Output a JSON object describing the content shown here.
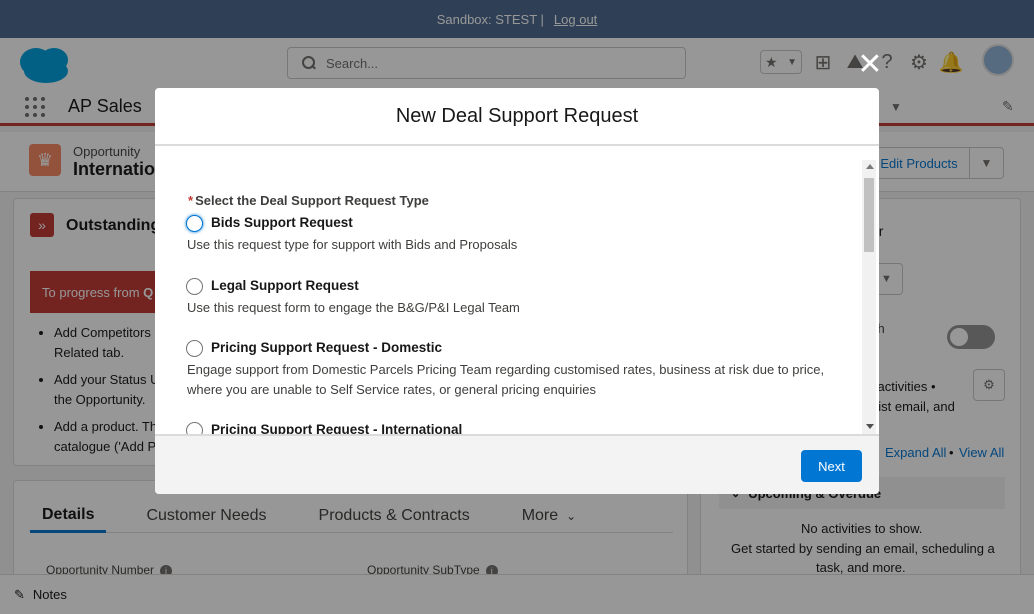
{
  "sandbox_bar": {
    "text": "Sandbox: STEST |",
    "logout": "Log out"
  },
  "global_header": {
    "search_placeholder": "Search..."
  },
  "nav": {
    "app_name": "AP Sales"
  },
  "record": {
    "type": "Opportunity",
    "name": "Internatio",
    "edit_products": "Edit Products"
  },
  "outstanding": {
    "title": "Outstanding",
    "banner_prefix": "To progress from ",
    "banner_bold": "Q",
    "items": [
      "Add Competitors\nRelated tab.",
      "Add your Status U\nthe Opportunity.",
      "Add a product. Th\ncatalogue ('Add P"
    ]
  },
  "details": {
    "tabs": [
      "Details",
      "Customer Needs",
      "Products & Contracts",
      "More"
    ],
    "fields": [
      "Opportunity Number",
      "Opportunity SubType"
    ]
  },
  "right_panel": {
    "r1": "er",
    "r2": "ith",
    "r3": "l activities •",
    "r4": "List email, and",
    "expand_all": "Expand All",
    "sep": "•",
    "view_all": "View All",
    "upcoming": "Upcoming & Overdue",
    "empty1": "No activities to show.",
    "empty2": "Get started by sending an email, scheduling a",
    "empty3": "task, and more."
  },
  "utility": {
    "notes": "Notes"
  },
  "modal": {
    "title": "New Deal Support Request",
    "required_label": "Select the Deal Support Request Type",
    "options": [
      {
        "title": "Bids Support Request",
        "desc": "Use this request type for support with Bids and Proposals"
      },
      {
        "title": "Legal Support Request",
        "desc": "Use this request form to engage the B&G/P&I Legal Team"
      },
      {
        "title": "Pricing Support Request - Domestic",
        "desc": "Engage support from Domestic Parcels Pricing Team regarding customised rates, business at risk due to price, where you are unable to Self Service rates, or general pricing enquiries"
      },
      {
        "title": "Pricing Support Request - International",
        "desc": ""
      }
    ],
    "next": "Next"
  }
}
